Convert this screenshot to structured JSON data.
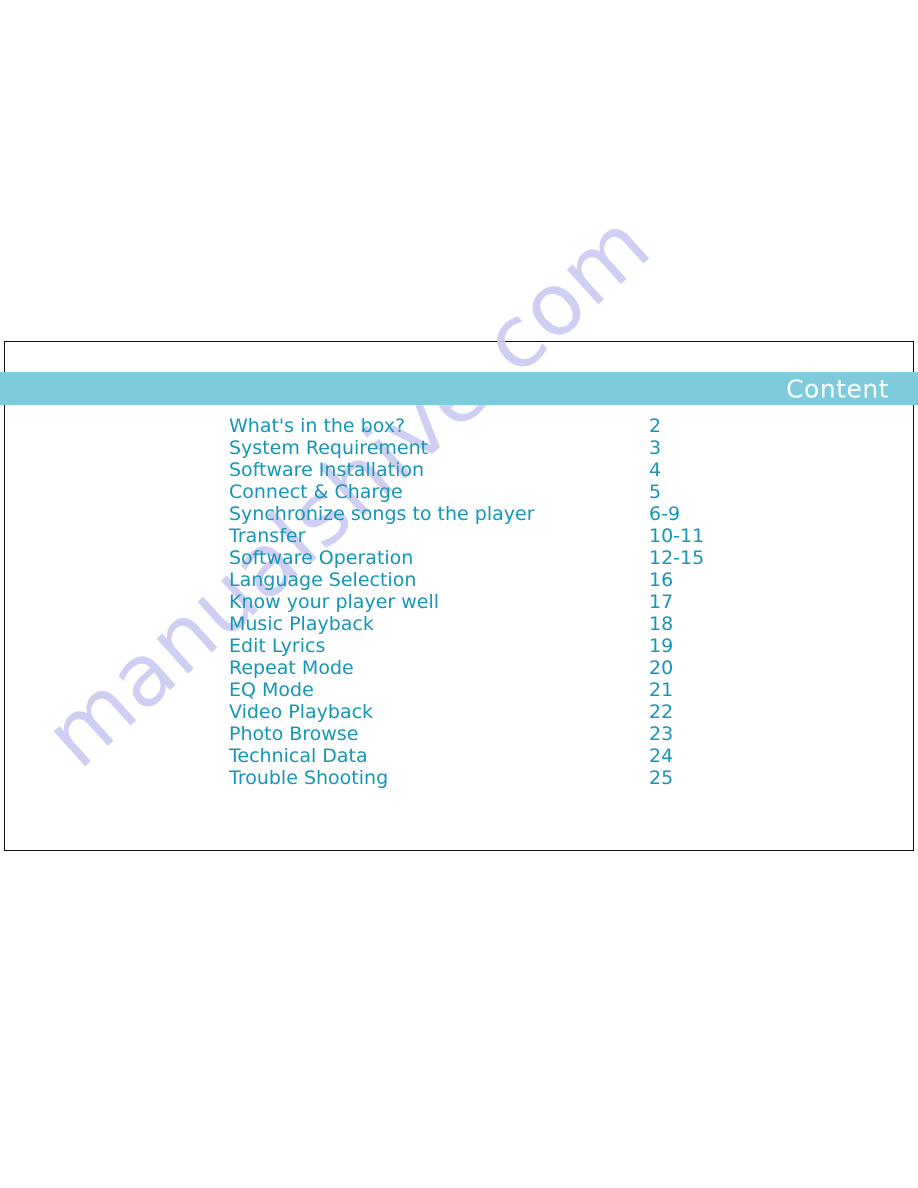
{
  "page": {
    "background_color": "#ffffff",
    "border_color": "#111111"
  },
  "header": {
    "title": "Content",
    "band_color": "#7ecbdb",
    "title_color": "#ffffff"
  },
  "toc": {
    "text_color": "#1596b6",
    "entries": [
      {
        "label": "What's in the box?",
        "page": "2"
      },
      {
        "label": "System Requirement",
        "page": "3"
      },
      {
        "label": "Software Installation",
        "page": "4"
      },
      {
        "label": "Connect & Charge",
        "page": "5"
      },
      {
        "label": "Synchronize  songs to the player",
        "page": "6-9"
      },
      {
        "label": "Transfer",
        "page": "10-11"
      },
      {
        "label": "Software Operation",
        "page": "12-15"
      },
      {
        "label": "Language Selection",
        "page": "16"
      },
      {
        "label": "Know your player well",
        "page": "17"
      },
      {
        "label": "Music Playback",
        "page": "18"
      },
      {
        "label": "Edit Lyrics",
        "page": "19"
      },
      {
        "label": "Repeat Mode",
        "page": "20"
      },
      {
        "label": "EQ Mode",
        "page": "21"
      },
      {
        "label": "Video Playback",
        "page": "22"
      },
      {
        "label": "Photo Browse",
        "page": "23"
      },
      {
        "label": "Technical Data",
        "page": "24"
      },
      {
        "label": "Trouble Shooting",
        "page": "25"
      }
    ]
  },
  "watermark": {
    "text": "manualshive.com",
    "color": "#c9c8f2"
  }
}
